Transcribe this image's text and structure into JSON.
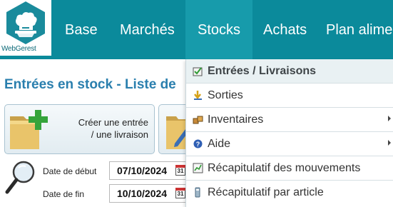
{
  "brand": {
    "name": "WebGerest"
  },
  "nav": {
    "items": [
      {
        "label": "Base"
      },
      {
        "label": "Marchés"
      },
      {
        "label": "Stocks"
      },
      {
        "label": "Achats"
      },
      {
        "label": "Plan alime"
      }
    ],
    "active": "Stocks",
    "bar_color": "#0b8a9b",
    "active_color": "#179bab"
  },
  "page": {
    "title": "Entrées en stock - Liste de",
    "create_tile": {
      "label": "Créer une entrée\n/ une livraison"
    },
    "dates": {
      "start_label": "Date de début",
      "start_value": "07/10/2024",
      "end_label": "Date de fin",
      "end_value": "10/10/2024",
      "calendar_glyph": "31"
    }
  },
  "stocks_menu": {
    "items": [
      {
        "label": "Entrées / Livraisons",
        "icon": "delivery-icon",
        "active": true
      },
      {
        "label": "Sorties",
        "icon": "exit-arrow-icon"
      },
      {
        "label": "Inventaires",
        "icon": "inventory-boxes-icon",
        "submenu": true
      },
      {
        "label": "Aide",
        "icon": "help-icon",
        "submenu": true
      },
      {
        "label": "Récapitulatif des mouvements",
        "icon": "movements-chart-icon"
      },
      {
        "label": "Récapitulatif par article",
        "icon": "article-summary-icon"
      }
    ]
  }
}
